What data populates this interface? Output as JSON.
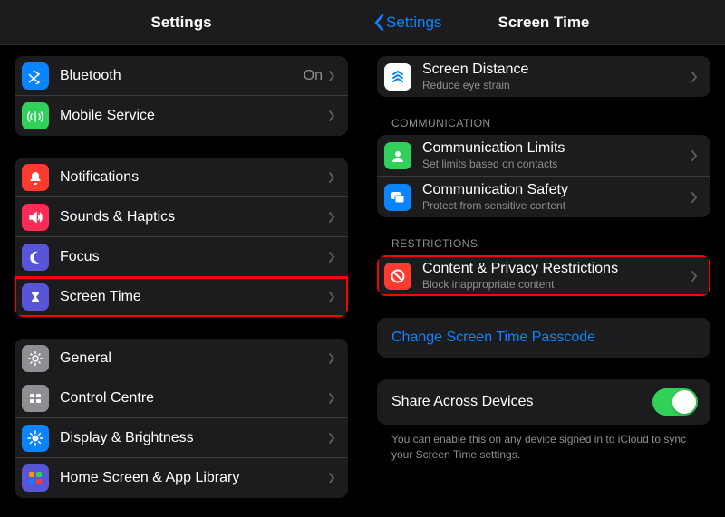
{
  "left": {
    "title": "Settings",
    "group1": [
      {
        "label": "Bluetooth",
        "value": "On",
        "icon": "bluetooth",
        "bg": "#0a84ff"
      },
      {
        "label": "Mobile Service",
        "icon": "antenna",
        "bg": "#30d158"
      }
    ],
    "group2": [
      {
        "label": "Notifications",
        "icon": "bell",
        "bg": "#ff3b30"
      },
      {
        "label": "Sounds & Haptics",
        "icon": "speaker",
        "bg": "#ff2d55"
      },
      {
        "label": "Focus",
        "icon": "moon",
        "bg": "#5856d6"
      },
      {
        "label": "Screen Time",
        "icon": "hourglass",
        "bg": "#5856d6",
        "highlight": true
      }
    ],
    "group3": [
      {
        "label": "General",
        "icon": "gear",
        "bg": "#8e8e93"
      },
      {
        "label": "Control Centre",
        "icon": "sliders",
        "bg": "#8e8e93"
      },
      {
        "label": "Display & Brightness",
        "icon": "sun",
        "bg": "#0a84ff"
      },
      {
        "label": "Home Screen & App Library",
        "icon": "grid",
        "bg": "#5856d6"
      }
    ]
  },
  "right": {
    "back": "Settings",
    "title": "Screen Time",
    "distance": {
      "label": "Screen Distance",
      "sub": "Reduce eye strain",
      "icon": "distance",
      "bg": "#ffffff"
    },
    "comm_header": "COMMUNICATION",
    "comm": [
      {
        "label": "Communication Limits",
        "sub": "Set limits based on contacts",
        "icon": "person",
        "bg": "#30d158"
      },
      {
        "label": "Communication Safety",
        "sub": "Protect from sensitive content",
        "icon": "chat",
        "bg": "#0a84ff"
      }
    ],
    "rest_header": "RESTRICTIONS",
    "rest": {
      "label": "Content & Privacy Restrictions",
      "sub": "Block inappropriate content",
      "icon": "block",
      "bg": "#ff3b30",
      "highlight": true
    },
    "change": "Change Screen Time Passcode",
    "share": "Share Across Devices",
    "share_footer": "You can enable this on any device signed in to iCloud to sync your Screen Time settings."
  }
}
